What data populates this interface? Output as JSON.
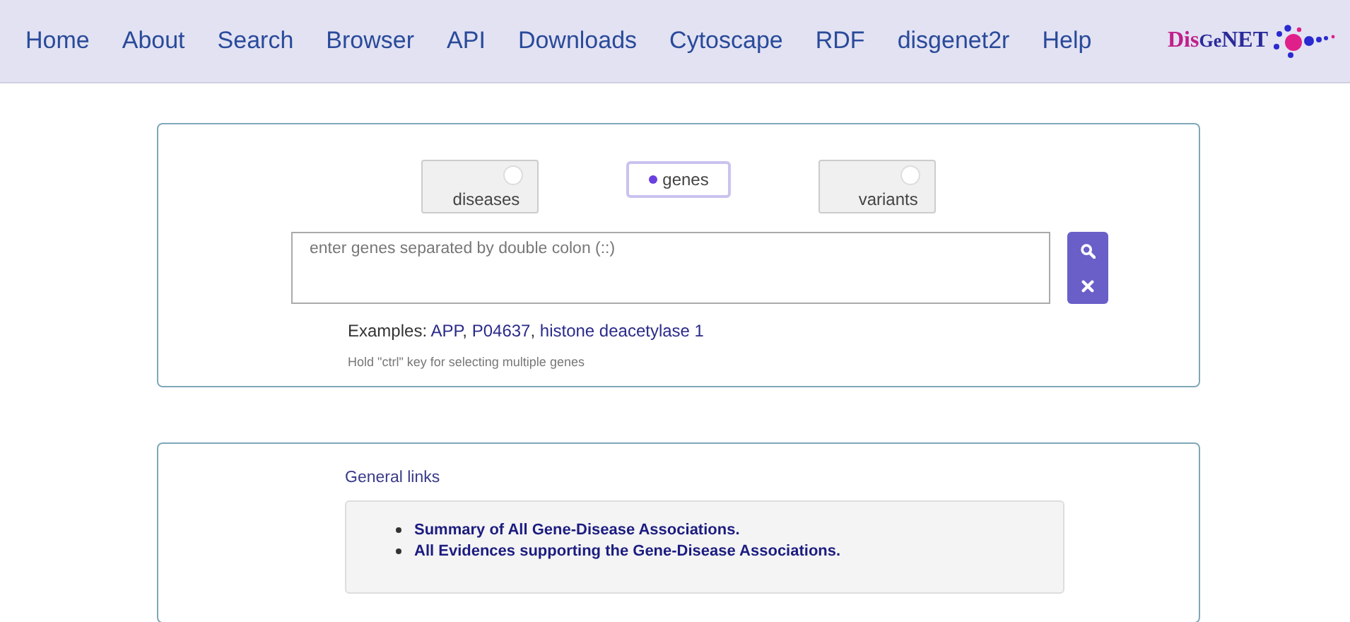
{
  "nav": {
    "items": [
      "Home",
      "About",
      "Search",
      "Browser",
      "API",
      "Downloads",
      "Cytoscape",
      "RDF",
      "disgenet2r",
      "Help"
    ],
    "logo": [
      "Dis",
      "Ge",
      "NET"
    ]
  },
  "search": {
    "options": [
      {
        "label": "diseases",
        "selected": false
      },
      {
        "label": "genes",
        "selected": true
      },
      {
        "label": "variants",
        "selected": false
      }
    ],
    "placeholder": "enter genes separated by double colon (::)",
    "examples": {
      "label": "Examples:",
      "separator": ", ",
      "links": [
        "APP",
        "P04637",
        "histone deacetylase 1"
      ]
    },
    "hint": "Hold \"ctrl\" key for selecting multiple genes"
  },
  "general_links": {
    "title": "General links",
    "links": [
      "Summary of All Gene-Disease Associations.",
      "All Evidences supporting the Gene-Disease Associations."
    ]
  }
}
